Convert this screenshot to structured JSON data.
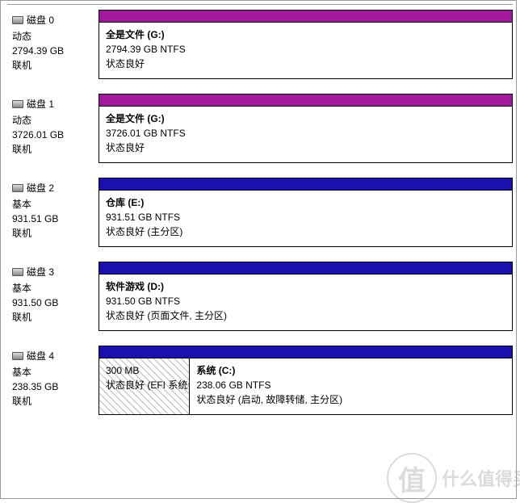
{
  "watermark": {
    "badge": "值",
    "text": "什么值得买"
  },
  "disks": [
    {
      "name": "磁盘 0",
      "type": "动态",
      "size": "2794.39 GB",
      "status": "联机",
      "headerColor": "#a1199d",
      "volumes": [
        {
          "name": "全是文件  (G:)",
          "size": "2794.39 GB NTFS",
          "status": "状态良好",
          "widthPct": 100,
          "hatched": false
        }
      ]
    },
    {
      "name": "磁盘 1",
      "type": "动态",
      "size": "3726.01 GB",
      "status": "联机",
      "headerColor": "#a1199d",
      "volumes": [
        {
          "name": "全是文件  (G:)",
          "size": "3726.01 GB NTFS",
          "status": "状态良好",
          "widthPct": 100,
          "hatched": false
        }
      ]
    },
    {
      "name": "磁盘 2",
      "type": "基本",
      "size": "931.51 GB",
      "status": "联机",
      "headerColor": "#1b0fb0",
      "volumes": [
        {
          "name": "仓库  (E:)",
          "size": "931.51 GB NTFS",
          "status": "状态良好 (主分区)",
          "widthPct": 100,
          "hatched": false
        }
      ]
    },
    {
      "name": "磁盘 3",
      "type": "基本",
      "size": "931.50 GB",
      "status": "联机",
      "headerColor": "#1b0fb0",
      "volumes": [
        {
          "name": "软件游戏  (D:)",
          "size": "931.50 GB NTFS",
          "status": "状态良好 (页面文件, 主分区)",
          "widthPct": 100,
          "hatched": false
        }
      ]
    },
    {
      "name": "磁盘 4",
      "type": "基本",
      "size": "238.35 GB",
      "status": "联机",
      "headerColor": "#1b0fb0",
      "volumes": [
        {
          "name": "",
          "size": "300 MB",
          "status": "状态良好 (EFI 系统分",
          "widthPct": 22,
          "hatched": true
        },
        {
          "name": "系统  (C:)",
          "size": "238.06 GB NTFS",
          "status": "状态良好 (启动, 故障转储, 主分区)",
          "widthPct": 78,
          "hatched": false
        }
      ]
    }
  ]
}
